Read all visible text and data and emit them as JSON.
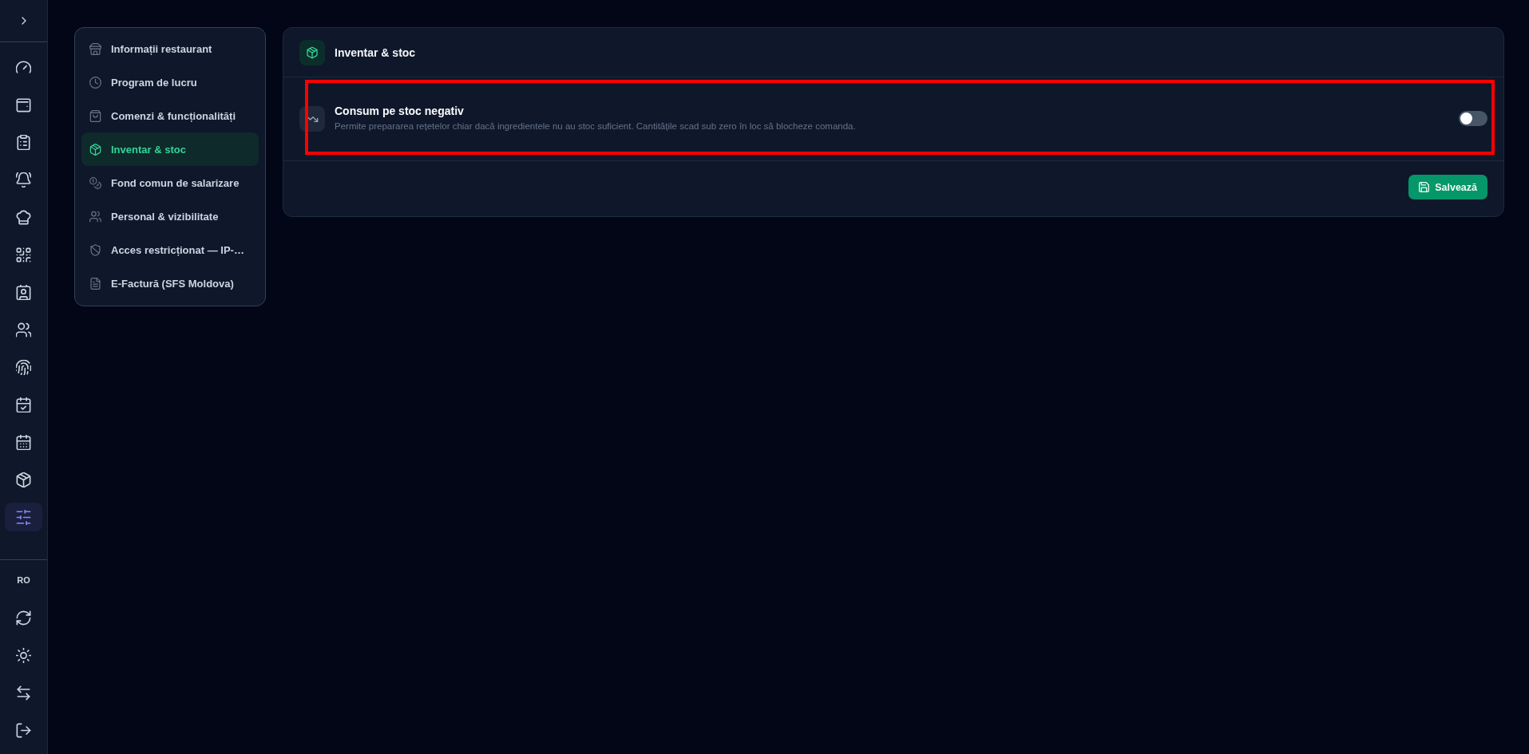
{
  "rail": {
    "nav_items": [
      {
        "selected": false
      },
      {
        "selected": false
      },
      {
        "selected": false
      },
      {
        "selected": false
      },
      {
        "selected": false
      },
      {
        "selected": false
      },
      {
        "selected": false
      },
      {
        "selected": false
      },
      {
        "selected": false
      },
      {
        "selected": false
      },
      {
        "selected": false
      },
      {
        "selected": false
      },
      {
        "selected": true
      }
    ],
    "language": "RO"
  },
  "settings_nav": [
    {
      "label": "Informații restaurant",
      "selected": false
    },
    {
      "label": "Program de lucru",
      "selected": false
    },
    {
      "label": "Comenzi & funcționalități",
      "selected": false
    },
    {
      "label": "Inventar & stoc",
      "selected": true
    },
    {
      "label": "Fond comun de salarizare",
      "selected": false
    },
    {
      "label": "Personal & vizibilitate",
      "selected": false
    },
    {
      "label": "Acces restricționat — IP-…",
      "selected": false
    },
    {
      "label": "E-Factură (SFS Moldova)",
      "selected": false
    }
  ],
  "panel": {
    "title": "Inventar & stoc",
    "settings": [
      {
        "title": "Consum pe stoc negativ",
        "description": "Permite prepararea rețetelor chiar dacă ingredientele nu au stoc suficient. Cantitățile scad sub zero în loc să blocheze comanda.",
        "on": false,
        "highlighted": true
      }
    ],
    "save_button": "Salvează"
  }
}
